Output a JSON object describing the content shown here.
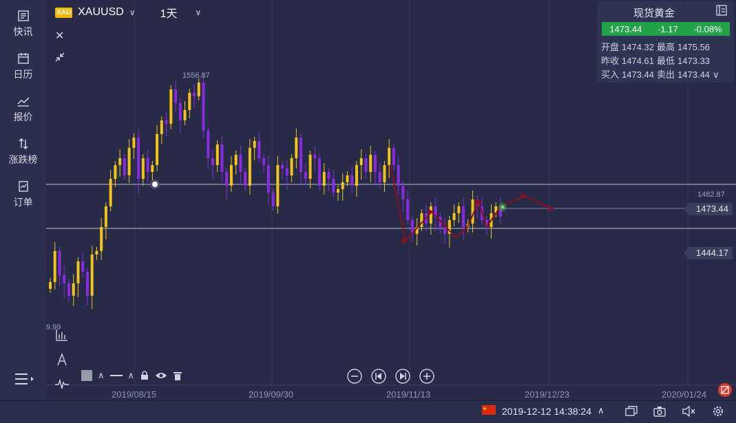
{
  "sidebar": {
    "items": [
      {
        "label": "快讯",
        "icon": "news-icon"
      },
      {
        "label": "日历",
        "icon": "calendar-icon"
      },
      {
        "label": "报价",
        "icon": "quote-chart-icon"
      },
      {
        "label": "涨跌榜",
        "icon": "updown-icon"
      },
      {
        "label": "订单",
        "icon": "order-icon"
      }
    ]
  },
  "header": {
    "badge": "XAU",
    "symbol": "XAUUSD",
    "period": "1天"
  },
  "quote": {
    "title": "现货黄金",
    "last": "1473.44",
    "change": "-1.17",
    "change_pct": "-0.08%",
    "open_label": "开盘",
    "open": "1474.32",
    "high_label": "最高",
    "high": "1475.56",
    "prev_label": "昨收",
    "prev": "1474.61",
    "low_label": "最低",
    "low": "1473.33",
    "bid_label": "买入",
    "bid": "1473.44",
    "ask_label": "卖出",
    "ask": "1473.44"
  },
  "price_labels": {
    "peak": "1556.87",
    "upper_line": "1482.87",
    "current": "1473.44",
    "lower_line": "1444.17",
    "low_cut": "9.99"
  },
  "xaxis": {
    "ticks": [
      "2019/08/15",
      "2019/09/30",
      "2019/11/13",
      "2019/12/23",
      "2020/01/24"
    ]
  },
  "statusbar": {
    "datetime": "2019-12-12 14:38:24"
  },
  "colors": {
    "bull": "#f0c419",
    "bear": "#8a2be2",
    "up_badge": "#22a34a",
    "arrow": "#8b0f1f"
  },
  "chart_data": {
    "type": "candlestick",
    "x_ticks": [
      "2019/08/15",
      "2019/09/30",
      "2019/11/13",
      "2019/12/23",
      "2020/01/24"
    ],
    "annotated_high": 1556.87,
    "horizontal_lines": [
      1482.87,
      1444.17
    ],
    "last_price": 1473.44,
    "grid": true
  }
}
